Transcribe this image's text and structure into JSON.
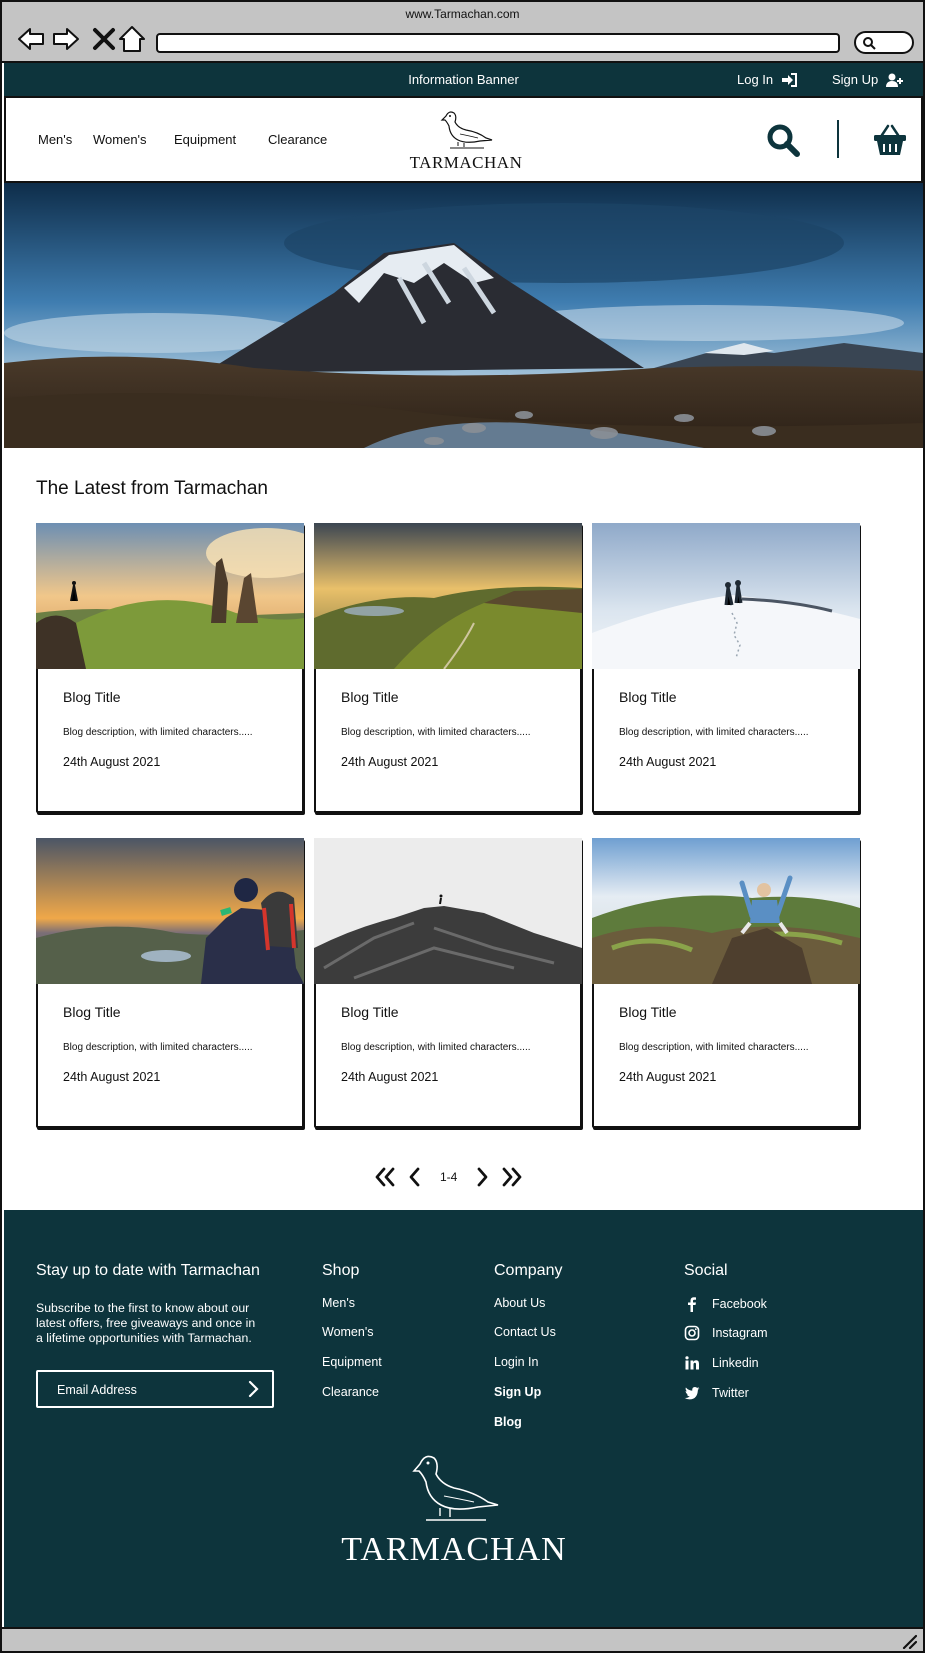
{
  "browser": {
    "url_title": "www.Tarmachan.com",
    "icons": [
      "back-arrow-icon",
      "forward-arrow-icon",
      "close-icon",
      "home-icon",
      "search-icon"
    ]
  },
  "info_banner": {
    "text": "Information Banner",
    "login": "Log In",
    "signup": "Sign Up"
  },
  "header": {
    "nav": [
      "Men's",
      "Women's",
      "Equipment",
      "Clearance"
    ],
    "logo_text": "TARMACHAN"
  },
  "latest": {
    "title": "The Latest from Tarmachan",
    "cards": [
      {
        "title": "Blog Title",
        "desc": "Blog description, with limited characters.....",
        "date": "24th August 2021"
      },
      {
        "title": "Blog Title",
        "desc": "Blog description, with limited characters.....",
        "date": "24th August 2021"
      },
      {
        "title": "Blog Title",
        "desc": "Blog description, with limited characters.....",
        "date": "24th August 2021"
      },
      {
        "title": "Blog Title",
        "desc": "Blog description, with limited characters.....",
        "date": "24th August 2021"
      },
      {
        "title": "Blog Title",
        "desc": "Blog description, with limited characters.....",
        "date": "24th August 2021"
      },
      {
        "title": "Blog Title",
        "desc": "Blog description, with limited characters.....",
        "date": "24th August 2021"
      }
    ]
  },
  "pagination": {
    "range": "1-4"
  },
  "footer": {
    "newsletter_title": "Stay up to date with Tarmachan",
    "newsletter_text": "Subscribe to the first to know about our latest offers, free giveaways and once in a lifetime opportunities with Tarmachan.",
    "email_placeholder": "Email Address",
    "shop_title": "Shop",
    "shop_links": [
      "Men's",
      "Women's",
      "Equipment",
      "Clearance"
    ],
    "company_title": "Company",
    "company_links": [
      "About Us",
      "Contact Us",
      "Login In",
      "Sign Up",
      "Blog"
    ],
    "social_title": "Social",
    "social_links": [
      "Facebook",
      "Instagram",
      "Linkedin",
      "Twitter"
    ],
    "logo_text": "TARMACHAN"
  },
  "colors": {
    "brand_dark": "#0d343c",
    "chrome_gray": "#c4c4c4"
  }
}
